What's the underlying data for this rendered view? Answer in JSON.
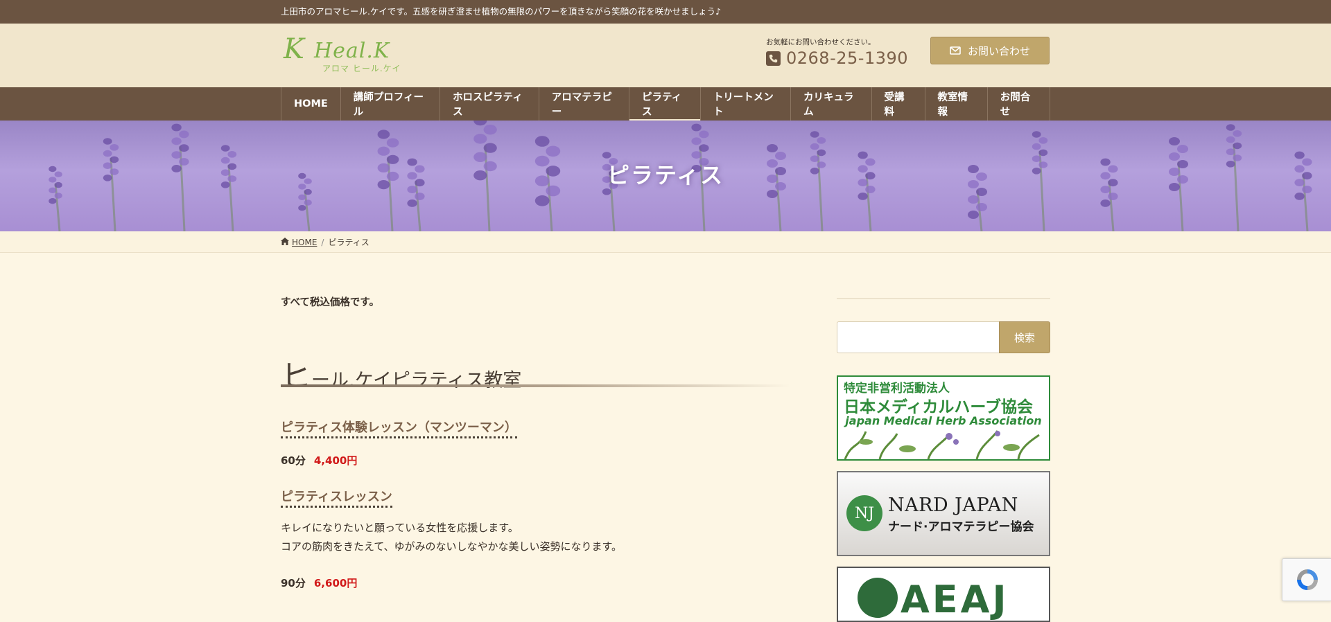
{
  "topbar": {
    "tagline": "上田市のアロマヒール.ケイです。五感を研ぎ澄ませ植物の無限のパワーを頂きながら笑顔の花を咲かせましょう♪"
  },
  "header": {
    "logo_initial": "K",
    "logo_word": "Heal.K",
    "logo_kana": "アロマ ヒール.ケイ",
    "contact_note": "お気軽にお問い合わせください。",
    "phone": "0268-25-1390",
    "contact_button": "お問い合わせ"
  },
  "nav": {
    "items": [
      {
        "label": "HOME"
      },
      {
        "label": "講師プロフィール"
      },
      {
        "label": "ホロスピラティス"
      },
      {
        "label": "アロマテラピー"
      },
      {
        "label": "ピラティス"
      },
      {
        "label": "トリートメント"
      },
      {
        "label": "カリキュラム"
      },
      {
        "label": "受講料"
      },
      {
        "label": "教室情報"
      },
      {
        "label": "お問合せ"
      }
    ],
    "active_index": 4
  },
  "hero": {
    "title": "ピラティス"
  },
  "breadcrumb": {
    "home": "HOME",
    "separator": "/",
    "current": "ピラティス"
  },
  "main": {
    "note": "すべて税込価格です。",
    "section_title_first": "ヒ",
    "section_title_rest": "ール.ケイピラティス教室",
    "trial": {
      "title": "ピラティス体験レッスン（マンツーマン）",
      "duration": "60分",
      "price": "4,400円"
    },
    "lesson": {
      "title": "ピラティスレッスン",
      "desc_line1": "キレイになりたいと願っている女性を応援します。",
      "desc_line2": "コアの筋肉をきたえて、ゆがみのないしなやかな美しい姿勢になります。",
      "duration": "90分",
      "price": "6,600円"
    }
  },
  "sidebar": {
    "search_button": "検索",
    "banner1": {
      "line1": "特定非営利活動法人",
      "line2": "日本メディカルハーブ協会",
      "line3": "japan Medical Herb Association"
    },
    "banner2": {
      "mark": "NJ",
      "line1": "NARD JAPAN",
      "line2": "ナード·アロマテラピー協会"
    },
    "banner3": {
      "text": "AEAJ"
    }
  },
  "colors": {
    "brown": "#6b5441",
    "cream": "#f1e6cc",
    "gold": "#c0a66b",
    "price_red": "#d11a1a",
    "green": "#2e8b3a"
  }
}
